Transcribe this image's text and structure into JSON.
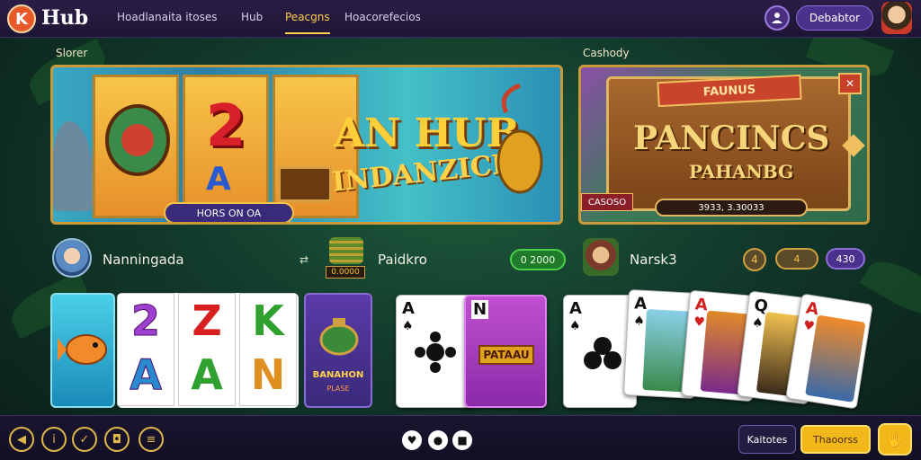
{
  "header": {
    "logo_letter": "K",
    "brand": "Hub",
    "nav": [
      "Hoadlanaita itoses",
      "Hub",
      "Peacgns",
      "Hoacorefecios"
    ],
    "active_nav": 2,
    "user_icon": "user-icon",
    "deposit_label": "Debabtor"
  },
  "sections": {
    "left_label": "Slorer",
    "right_label": "Cashody"
  },
  "banner_left": {
    "title": "AN HUB",
    "subtitle": "INDANZICH",
    "reel_symbol": "2",
    "reel_symbol_2": "A",
    "button_label": "HORS ON OA"
  },
  "banner_right": {
    "ribbon": "FAUNUS",
    "title": "PANCINCS",
    "subtitle": "PAHANBG",
    "badge": "CASOSO",
    "bar_value": "3933, 3.30033"
  },
  "players": [
    {
      "name": "Nanningada"
    },
    {
      "name": "Paidkro",
      "chip_label": "0 2000"
    },
    {
      "name": "Narsk3",
      "coin_1": "4",
      "coin_2": "4",
      "chip_label": "430"
    }
  ],
  "coin_stack_label": "0.0000",
  "slots": {
    "top": [
      "2",
      "Z",
      "K"
    ],
    "bottom": [
      "A",
      "A",
      "N"
    ],
    "side_tile_label": "BANAHON",
    "side_tile_sub": "PLASE"
  },
  "cards_left": [
    {
      "rank": "A",
      "suit": "♠"
    },
    {
      "rank": "N",
      "suit": "♠",
      "label": "PATAAU"
    }
  ],
  "cards_right": [
    {
      "rank": "A",
      "suit": "♠"
    },
    {
      "rank": "A",
      "suit": "♠"
    },
    {
      "rank": "A",
      "suit": "♥"
    },
    {
      "rank": "Q",
      "suit": "♠"
    },
    {
      "rank": "A",
      "suit": "♥"
    }
  ],
  "bottom": {
    "left_icons": [
      "compass-icon",
      "info-icon",
      "shield-icon",
      "lock-icon",
      "menu-icon"
    ],
    "center_icons": [
      "heart-icon",
      "pin-icon",
      "stop-icon"
    ],
    "secondary_label": "Kaitotes",
    "primary_label": "Thaoorss",
    "corner_icon": "hand-icon"
  }
}
